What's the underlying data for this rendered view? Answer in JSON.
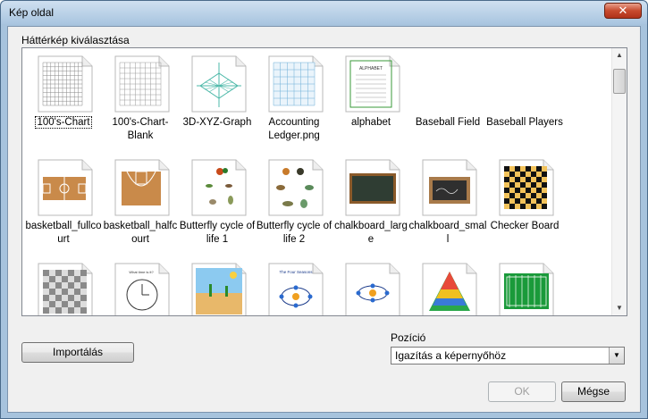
{
  "window": {
    "title": "Kép oldal",
    "close_glyph": "✕"
  },
  "gallery": {
    "label": "Háttérkép kiválasztása",
    "items": [
      {
        "caption": "100's-Chart",
        "icon": "hundreds-chart-icon",
        "selected": true
      },
      {
        "caption": "100's-Chart-Blank",
        "icon": "blank-grid-icon"
      },
      {
        "caption": "3D-XYZ-Graph",
        "icon": "3d-graph-icon"
      },
      {
        "caption": "Accounting Ledger.png",
        "icon": "ledger-icon"
      },
      {
        "caption": "alphabet",
        "icon": "alphabet-icon"
      },
      {
        "caption": "Baseball Field",
        "icon": "baseball-field-icon"
      },
      {
        "caption": "Baseball Players",
        "icon": "baseball-players-icon"
      },
      {
        "caption": "basketball_fullcourt",
        "icon": "basketball-fullcourt-icon"
      },
      {
        "caption": "basketball_halfcourt",
        "icon": "basketball-halfcourt-icon"
      },
      {
        "caption": "Butterfly cycle of life 1",
        "icon": "butterfly-cycle-icon"
      },
      {
        "caption": "Butterfly cycle of life 2",
        "icon": "butterfly-cycle-2-icon"
      },
      {
        "caption": "chalkboard_large",
        "icon": "chalkboard-large-icon"
      },
      {
        "caption": "chalkboard_small",
        "icon": "chalkboard-small-icon"
      },
      {
        "caption": "Checker Board",
        "icon": "checkerboard-icon"
      },
      {
        "caption": "",
        "icon": "gray-checkerboard-icon"
      },
      {
        "caption": "",
        "icon": "clock-icon"
      },
      {
        "caption": "",
        "icon": "desert-icon"
      },
      {
        "caption": "",
        "icon": "four-seasons-icon"
      },
      {
        "caption": "",
        "icon": "cycle-diagram-icon"
      },
      {
        "caption": "",
        "icon": "pyramid-icon"
      },
      {
        "caption": "",
        "icon": "football-field-icon"
      }
    ]
  },
  "buttons": {
    "import": "Importálás",
    "ok": "OK",
    "cancel": "Mégse"
  },
  "position": {
    "label": "Pozíció",
    "selected": "Igazítás a képernyőhöz"
  }
}
